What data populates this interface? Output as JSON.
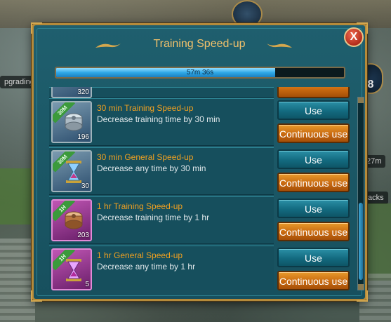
{
  "background": {
    "left_status": "pgrading",
    "right_timer": "27m",
    "right_tab": "acks",
    "badge_value": "8"
  },
  "dialog": {
    "title": "Training Speed-up",
    "close_label": "X",
    "progress": {
      "label": "57m 36s",
      "fraction": 0.76
    },
    "partial_item": {
      "count": "320"
    },
    "items": [
      {
        "name": "30 min Training Speed-up",
        "description": "Decrease training time by 30 min",
        "count": "196",
        "tag": "30M",
        "icon": "training-drum-icon",
        "use_label": "Use",
        "continuous_label": "Continuous use"
      },
      {
        "name": "30 min General Speed-up",
        "description": "Decrease any time by 30 min",
        "count": "30",
        "tag": "30M",
        "icon": "hourglass-icon",
        "use_label": "Use",
        "continuous_label": "Continuous use"
      },
      {
        "name": "1 hr Training Speed-up",
        "description": "Decrease training time by 1 hr",
        "count": "203",
        "tag": "1H",
        "icon": "training-drum-icon",
        "use_label": "Use",
        "continuous_label": "Continuous use"
      },
      {
        "name": "1 hr General Speed-up",
        "description": "Decrease any time by 1 hr",
        "count": "5",
        "tag": "1H",
        "icon": "hourglass-icon",
        "use_label": "Use",
        "continuous_label": "Continuous use"
      }
    ]
  },
  "colors": {
    "title": "#f1c16b",
    "item_name": "#f0a020",
    "use_button": "#136b80",
    "continuous_button": "#c96a10",
    "progress": "#2fa8e6"
  }
}
